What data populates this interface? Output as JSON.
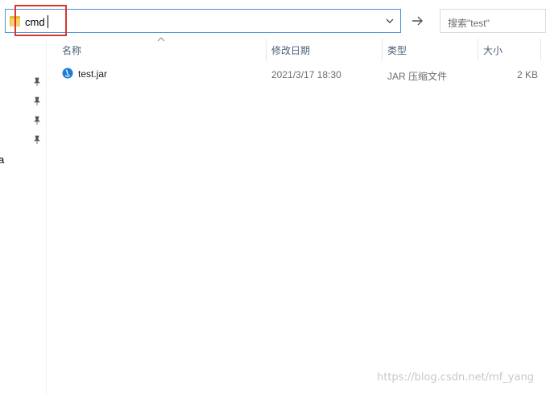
{
  "address_bar": {
    "value": "cmd",
    "icon": "folder-icon"
  },
  "go_button": {
    "icon": "arrow-right-icon"
  },
  "search": {
    "placeholder": "搜索\"test\""
  },
  "nav_pane": {
    "pins": [
      "pin-icon",
      "pin-icon",
      "pin-icon",
      "pin-icon"
    ],
    "clipped_text": "a"
  },
  "columns": {
    "name": "名称",
    "date": "修改日期",
    "type": "类型",
    "size": "大小"
  },
  "files": [
    {
      "name": "test.jar",
      "date": "2021/3/17 18:30",
      "type": "JAR 压缩文件",
      "size": "2 KB",
      "icon": "java-jar-icon"
    }
  ],
  "watermark": "https://blog.csdn.net/mf_yang",
  "colors": {
    "highlight_border": "#d9362f",
    "address_border": "#4a90d9",
    "header_text": "#4c607a"
  }
}
